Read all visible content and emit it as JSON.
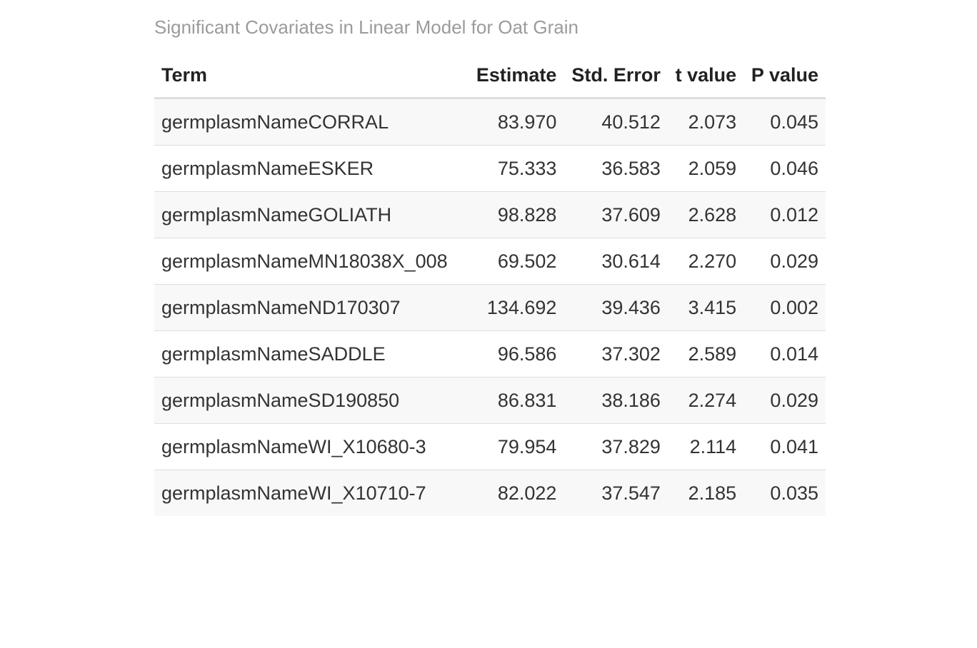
{
  "table": {
    "caption": "Significant Covariates in Linear Model for Oat Grain",
    "headers": [
      "Term",
      "Estimate",
      "Std. Error",
      "t value",
      "P value"
    ],
    "rows": [
      [
        "germplasmNameCORRAL",
        "83.970",
        "40.512",
        "2.073",
        "0.045"
      ],
      [
        "germplasmNameESKER",
        "75.333",
        "36.583",
        "2.059",
        "0.046"
      ],
      [
        "germplasmNameGOLIATH",
        "98.828",
        "37.609",
        "2.628",
        "0.012"
      ],
      [
        "germplasmNameMN18038X_008",
        "69.502",
        "30.614",
        "2.270",
        "0.029"
      ],
      [
        "germplasmNameND170307",
        "134.692",
        "39.436",
        "3.415",
        "0.002"
      ],
      [
        "germplasmNameSADDLE",
        "96.586",
        "37.302",
        "2.589",
        "0.014"
      ],
      [
        "germplasmNameSD190850",
        "86.831",
        "38.186",
        "2.274",
        "0.029"
      ],
      [
        "germplasmNameWI_X10680-3",
        "79.954",
        "37.829",
        "2.114",
        "0.041"
      ],
      [
        "germplasmNameWI_X10710-7",
        "82.022",
        "37.547",
        "2.185",
        "0.035"
      ]
    ]
  }
}
